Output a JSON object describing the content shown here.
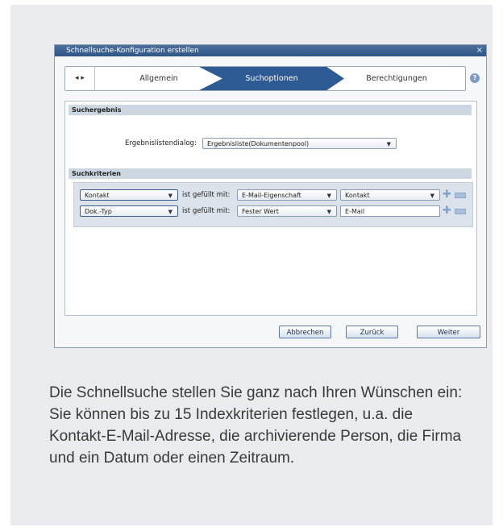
{
  "dialog": {
    "title": "Schnellsuche-Konfiguration erstellen",
    "close_glyph": "×"
  },
  "wizard": {
    "nav_glyph": "◂ ▸",
    "steps": [
      "Allgemein",
      "Suchoptionen",
      "Berechtigungen"
    ],
    "active_step": "Suchoptionen",
    "help_glyph": "?"
  },
  "suchergebnis": {
    "heading": "Suchergebnis",
    "label": "Ergebnislistendialog:",
    "value": "Ergebnisliste(Dokumentenpool)"
  },
  "suchkriterien": {
    "heading": "Suchkriterien",
    "rows": [
      {
        "field": "Kontakt",
        "connector": "ist gefüllt mit:",
        "type": "E-Mail-Eigenschaft",
        "value": "Kontakt"
      },
      {
        "field": "Dok.-Typ",
        "connector": "ist gefüllt mit:",
        "type": "Fester Wert",
        "value": "E-Mail"
      }
    ]
  },
  "buttons": {
    "cancel": "Abbrechen",
    "back": "Zurück",
    "next": "Weiter"
  },
  "caption": "Die Schnellsuche stellen Sie ganz nach Ihren Wünschen ein: Sie können bis zu 15 Indexkriterien festlegen, u.a. die Kontakt-E-Mail-Adresse, die archivierende Person, die Firma und ein Datum oder einen Zeitraum.",
  "icons": {
    "select_arrow": "▼",
    "plus": "✚"
  },
  "colors": {
    "accent": "#2f5b94",
    "titlebar": "#3b6293",
    "section": "#cdd7e2",
    "card": "#e9ebee"
  }
}
